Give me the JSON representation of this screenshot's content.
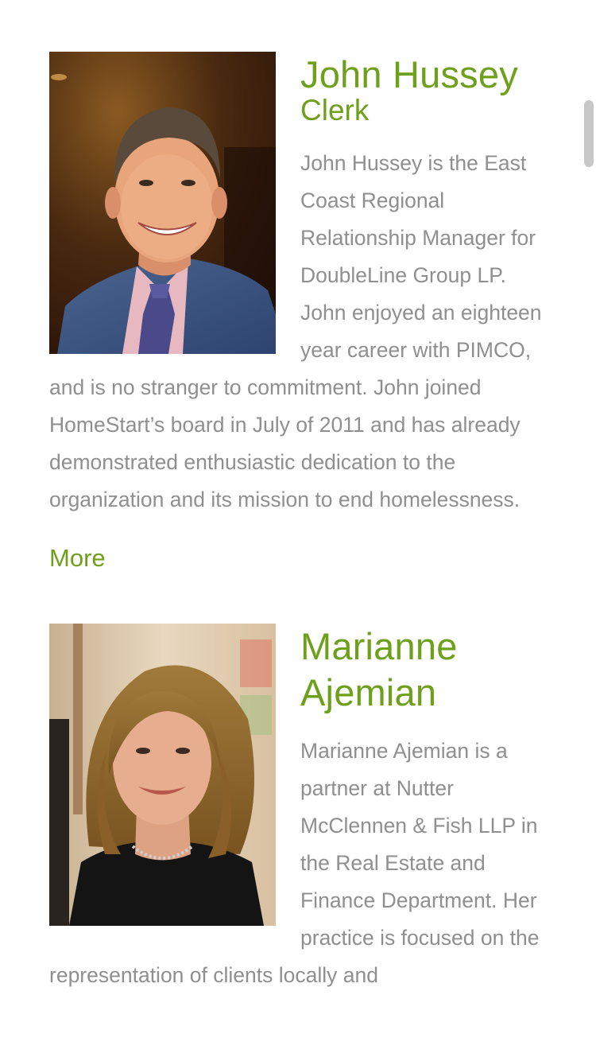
{
  "members": [
    {
      "name": "John Hussey",
      "role": "Clerk",
      "bio": "John Hussey is the East Coast Regional Relationship Manager for DoubleLine Group LP. John enjoyed an eighteen year career with PIMCO, and is no stranger to commitment. John joined HomeStart’s board in July of 2011 and has already demonstrated enthusiastic dedication to the organization and its mission to end homelessness.",
      "more_label": "More"
    },
    {
      "name": "Marianne Ajemian",
      "role": "",
      "bio": "Marianne Ajemian is a partner at Nutter McClennen & Fish LLP in the Real Estate and Finance Department. Her practice is focused on the representation of clients locally and",
      "more_label": ""
    }
  ],
  "colors": {
    "accent": "#6ea01c",
    "body_text": "#8f8f8f",
    "background": "#ffffff",
    "scrollbar": "#c7c7c7"
  }
}
